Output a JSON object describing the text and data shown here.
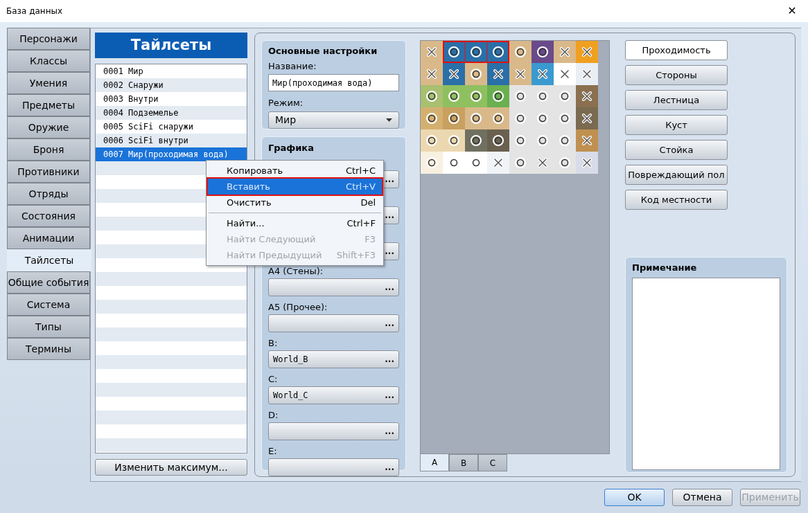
{
  "window": {
    "title": "База данных",
    "close": "✕"
  },
  "nav": [
    {
      "label": "Персонажи",
      "selected": false
    },
    {
      "label": "Классы",
      "selected": false
    },
    {
      "label": "Умения",
      "selected": false
    },
    {
      "label": "Предметы",
      "selected": false
    },
    {
      "label": "Оружие",
      "selected": false
    },
    {
      "label": "Броня",
      "selected": false
    },
    {
      "label": "Противники",
      "selected": false
    },
    {
      "label": "Отряды",
      "selected": false
    },
    {
      "label": "Состояния",
      "selected": false
    },
    {
      "label": "Анимации",
      "selected": false
    },
    {
      "label": "Тайлсеты",
      "selected": true
    },
    {
      "label": "Общие события",
      "selected": false
    },
    {
      "label": "Система",
      "selected": false
    },
    {
      "label": "Типы",
      "selected": false
    },
    {
      "label": "Термины",
      "selected": false
    }
  ],
  "list": {
    "title": "Тайлсеты",
    "items": [
      {
        "label": "0001 Мир",
        "selected": false
      },
      {
        "label": "0002 Снаружи",
        "selected": false
      },
      {
        "label": "0003 Внутри",
        "selected": false
      },
      {
        "label": "0004 Подземелье",
        "selected": false
      },
      {
        "label": "0005 SciFi снаружи",
        "selected": false
      },
      {
        "label": "0006 SciFi внутри",
        "selected": false
      },
      {
        "label": "0007 Мир(проходимая вода)",
        "selected": true
      }
    ],
    "max_button": "Изменить максимум..."
  },
  "basic": {
    "title": "Основные настройки",
    "name_label": "Название:",
    "name_value": "Мир(проходимая вода)",
    "mode_label": "Режим:",
    "mode_value": "Мир"
  },
  "graphics": {
    "title": "Графика",
    "slots": [
      {
        "browse": "..."
      },
      {
        "browse": "..."
      },
      {
        "browse": "..."
      },
      {
        "label": "A4 (Стены):",
        "browse": "..."
      },
      {
        "label": "A5 (Прочее):",
        "browse": "..."
      },
      {
        "label": "B:",
        "value": "World_B",
        "browse": "..."
      },
      {
        "label": "C:",
        "value": "World_C",
        "browse": "..."
      },
      {
        "label": "D:",
        "browse": "..."
      },
      {
        "label": "E:",
        "browse": "..."
      }
    ]
  },
  "context_menu": [
    {
      "kind": "item",
      "label": "Копировать",
      "shortcut": "Ctrl+C",
      "disabled": false,
      "selected": false
    },
    {
      "kind": "item",
      "label": "Вставить",
      "shortcut": "Ctrl+V",
      "disabled": false,
      "selected": true
    },
    {
      "kind": "item",
      "label": "Очистить",
      "shortcut": "Del",
      "disabled": false,
      "selected": false
    },
    {
      "kind": "separator"
    },
    {
      "kind": "item",
      "label": "Найти...",
      "shortcut": "Ctrl+F",
      "disabled": false,
      "selected": false
    },
    {
      "kind": "item",
      "label": "Найти Следующий",
      "shortcut": "F3",
      "disabled": true,
      "selected": false
    },
    {
      "kind": "item",
      "label": "Найти Предыдущий",
      "shortcut": "Shift+F3",
      "disabled": true,
      "selected": false
    }
  ],
  "tiles": [
    [
      {
        "color": "#d9b98a",
        "passable": false,
        "selected": false
      },
      {
        "color": "#2a6fa8",
        "passable": true,
        "selected": true
      },
      {
        "color": "#2a6fa8",
        "passable": true,
        "selected": true
      },
      {
        "color": "#2a6fa8",
        "passable": true,
        "selected": true
      },
      {
        "color": "#d9b98a",
        "passable": true,
        "selected": false
      },
      {
        "color": "#6a4a8a",
        "passable": true,
        "selected": false
      },
      {
        "color": "#d9b98a",
        "passable": false,
        "selected": false
      },
      {
        "color": "#f0a020",
        "passable": false,
        "selected": false
      }
    ],
    [
      {
        "color": "#d9b98a",
        "passable": false,
        "selected": false
      },
      {
        "color": "#2a6fa8",
        "passable": false,
        "selected": false
      },
      {
        "color": "#d9b98a",
        "passable": true,
        "selected": false
      },
      {
        "color": "#2a6fa8",
        "passable": false,
        "selected": false
      },
      {
        "color": "#d9b98a",
        "passable": false,
        "selected": false
      },
      {
        "color": "#3a9ad0",
        "passable": false,
        "selected": false
      },
      {
        "color": "#ffffff",
        "passable": false,
        "selected": false
      },
      {
        "color": "#e8eef4",
        "passable": false,
        "selected": false
      }
    ],
    [
      {
        "color": "#a8c070",
        "passable": true,
        "selected": false
      },
      {
        "color": "#8fc060",
        "passable": true,
        "selected": false
      },
      {
        "color": "#8fc060",
        "passable": true,
        "selected": false
      },
      {
        "color": "#6ab050",
        "passable": true,
        "selected": false
      },
      {
        "color": "#e4e4e4",
        "passable": true,
        "selected": false
      },
      {
        "color": "#e4e4e4",
        "passable": true,
        "selected": false
      },
      {
        "color": "#e4e4e4",
        "passable": true,
        "selected": false
      },
      {
        "color": "#8a7050",
        "passable": false,
        "selected": false
      }
    ],
    [
      {
        "color": "#d4b070",
        "passable": true,
        "selected": false
      },
      {
        "color": "#c8a060",
        "passable": true,
        "selected": false
      },
      {
        "color": "#d9b98a",
        "passable": true,
        "selected": false
      },
      {
        "color": "#d9b98a",
        "passable": true,
        "selected": false
      },
      {
        "color": "#e4e4e4",
        "passable": true,
        "selected": false
      },
      {
        "color": "#e4e4e4",
        "passable": true,
        "selected": false
      },
      {
        "color": "#e4e4e4",
        "passable": true,
        "selected": false
      },
      {
        "color": "#7a6a50",
        "passable": false,
        "selected": false
      }
    ],
    [
      {
        "color": "#ecd8b0",
        "passable": true,
        "selected": false
      },
      {
        "color": "#ecd8b0",
        "passable": true,
        "selected": false
      },
      {
        "color": "#707060",
        "passable": true,
        "selected": false
      },
      {
        "color": "#6a6050",
        "passable": true,
        "selected": false
      },
      {
        "color": "#e4e4e4",
        "passable": true,
        "selected": false
      },
      {
        "color": "#e4e4e4",
        "passable": true,
        "selected": false
      },
      {
        "color": "#e4e4e4",
        "passable": true,
        "selected": false
      },
      {
        "color": "#c09050",
        "passable": false,
        "selected": false
      }
    ],
    [
      {
        "color": "#f8f0e0",
        "passable": true,
        "selected": false
      },
      {
        "color": "#ffffff",
        "passable": true,
        "selected": false
      },
      {
        "color": "#ffffff",
        "passable": true,
        "selected": false
      },
      {
        "color": "#f0f4f8",
        "passable": false,
        "selected": false
      },
      {
        "color": "#e4e4e4",
        "passable": true,
        "selected": false
      },
      {
        "color": "#e4e4e4",
        "passable": false,
        "selected": false
      },
      {
        "color": "#e4e4e4",
        "passable": true,
        "selected": false
      },
      {
        "color": "#d8dce8",
        "passable": false,
        "selected": false
      }
    ]
  ],
  "tile_tabs": [
    {
      "label": "A",
      "selected": true
    },
    {
      "label": "B",
      "selected": false
    },
    {
      "label": "C",
      "selected": false
    }
  ],
  "modes": [
    {
      "label": "Проходимость",
      "selected": true
    },
    {
      "label": "Стороны",
      "selected": false
    },
    {
      "label": "Лестница",
      "selected": false
    },
    {
      "label": "Куст",
      "selected": false
    },
    {
      "label": "Стойка",
      "selected": false
    },
    {
      "label": "Повреждающий пол",
      "selected": false
    },
    {
      "label": "Код местности",
      "selected": false
    }
  ],
  "note": {
    "title": "Примечание"
  },
  "footer": [
    {
      "label": "OK",
      "kind": "default",
      "disabled": false
    },
    {
      "label": "Отмена",
      "kind": "normal",
      "disabled": false
    },
    {
      "label": "Применить",
      "kind": "normal",
      "disabled": true
    }
  ]
}
